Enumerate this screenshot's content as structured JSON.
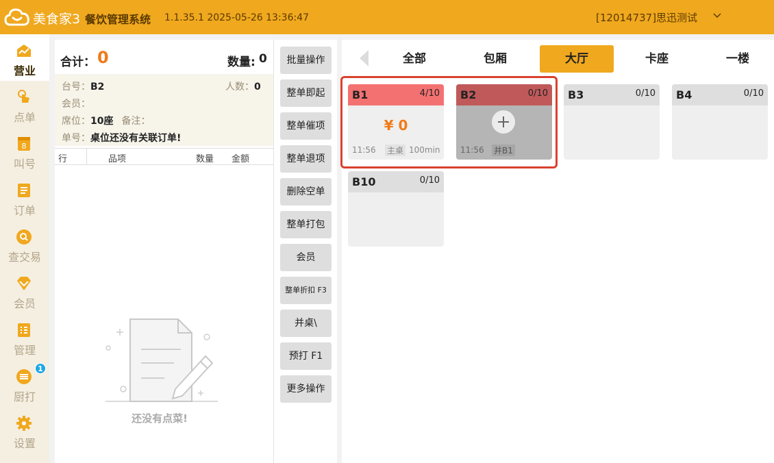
{
  "header": {
    "brand": "美食家3",
    "system_name": "餐饮管理系统",
    "version_time": "1.1.35.1 2025-05-26 13:36:47",
    "user": "[12014737]思迅测试"
  },
  "colors": {
    "accent": "#f0a81e",
    "highlight": "#d9412e",
    "amount": "#ef7b1a",
    "occupied_main": "#f47171",
    "occupied_joined": "#c0595a"
  },
  "nav": [
    {
      "label": "营业",
      "icon": "store-icon",
      "active": true
    },
    {
      "label": "点单",
      "icon": "tap-hand-icon"
    },
    {
      "label": "叫号",
      "icon": "number-icon"
    },
    {
      "label": "订单",
      "icon": "list-icon"
    },
    {
      "label": "查交易",
      "icon": "search-icon"
    },
    {
      "label": "会员",
      "icon": "diamond-icon"
    },
    {
      "label": "管理",
      "icon": "checklist-icon"
    },
    {
      "label": "厨打",
      "icon": "kitchen-print-icon",
      "badge": "1"
    },
    {
      "label": "设置",
      "icon": "gear-icon"
    }
  ],
  "order": {
    "total_label": "合计：",
    "total_value": "0",
    "qty_label": "数量:",
    "qty_value": "0",
    "table_label": "台号：",
    "table_value": "B2",
    "guests_label": "人数：",
    "guests_value": "0",
    "member_label": "会员：",
    "seat_label": "席位：",
    "seat_value": "10座",
    "note_label": "备注：",
    "order_no_label": "单号：",
    "order_no_value": "桌位还没有关联订单!",
    "columns": [
      "行",
      "品项",
      "数量",
      "金额"
    ],
    "empty_text": "还没有点菜!"
  },
  "actions": [
    {
      "label": "批量操作"
    },
    {
      "label": "整单即起"
    },
    {
      "label": "整单催项"
    },
    {
      "label": "整单退项"
    },
    {
      "label": "删除空单"
    },
    {
      "label": "整单打包"
    },
    {
      "label": "会员"
    },
    {
      "label": "整单折扣  F3",
      "small": true
    },
    {
      "label": "并桌\\"
    },
    {
      "label": "预打 F1"
    },
    {
      "label": "更多操作"
    }
  ],
  "areas": {
    "tabs": [
      "全部",
      "包厢",
      "大厅",
      "卡座",
      "一楼"
    ],
    "active": "大厅"
  },
  "tables": [
    {
      "name": "B1",
      "capacity": "4/10",
      "status": "occupied",
      "amount": "¥ 0",
      "time": "11:56",
      "tag": "主桌",
      "duration": "100min"
    },
    {
      "name": "B2",
      "capacity": "0/10",
      "status": "joined",
      "time": "11:56",
      "tag": "并B1"
    },
    {
      "name": "B3",
      "capacity": "0/10",
      "status": "free"
    },
    {
      "name": "B4",
      "capacity": "0/10",
      "status": "free"
    },
    {
      "name": "B10",
      "capacity": "0/10",
      "status": "free"
    }
  ]
}
